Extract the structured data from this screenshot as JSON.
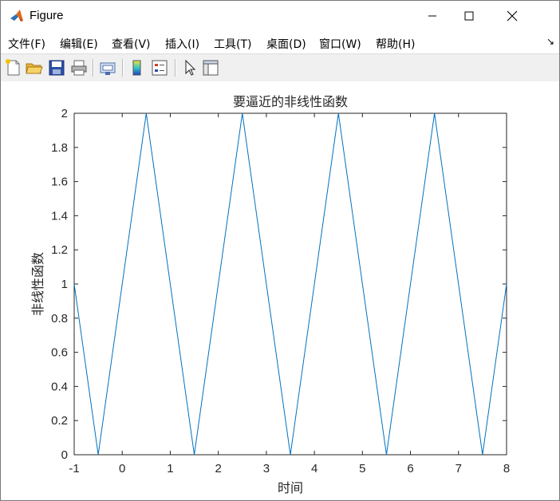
{
  "window": {
    "title": "Figure"
  },
  "menu": {
    "items": [
      {
        "label": "文件(F)",
        "name": "menu-file"
      },
      {
        "label": "编辑(E)",
        "name": "menu-edit"
      },
      {
        "label": "查看(V)",
        "name": "menu-view"
      },
      {
        "label": "插入(I)",
        "name": "menu-insert"
      },
      {
        "label": "工具(T)",
        "name": "menu-tools"
      },
      {
        "label": "桌面(D)",
        "name": "menu-desktop"
      },
      {
        "label": "窗口(W)",
        "name": "menu-window"
      },
      {
        "label": "帮助(H)",
        "name": "menu-help"
      }
    ],
    "extra": "↘"
  },
  "toolbar": {
    "icons": [
      "new-figure-icon",
      "open-file-icon",
      "save-icon",
      "print-icon",
      "link-plot-icon",
      "colorbar-icon",
      "legend-icon",
      "pointer-icon",
      "property-inspector-icon"
    ]
  },
  "chart_data": {
    "type": "line",
    "title": "要逼近的非线性函数",
    "xlabel": "时间",
    "ylabel": "非线性函数",
    "xlim": [
      -1,
      8
    ],
    "ylim": [
      0,
      2
    ],
    "xticks": [
      -1,
      0,
      1,
      2,
      3,
      4,
      5,
      6,
      7,
      8
    ],
    "yticks": [
      0,
      0.2,
      0.4,
      0.6,
      0.8,
      1,
      1.2,
      1.4,
      1.6,
      1.8,
      2
    ],
    "ytick_labels": [
      "0",
      "0.2",
      "0.4",
      "0.6",
      "0.8",
      "1",
      "1.2",
      "1.4",
      "1.6",
      "1.8",
      "2"
    ],
    "grid": false,
    "series": [
      {
        "color": "#0072bd",
        "x": [
          -1,
          -0.5,
          0.5,
          1.5,
          2.5,
          3.5,
          4.5,
          5.5,
          6.5,
          7.5,
          8
        ],
        "y": [
          1,
          0,
          2,
          0,
          2,
          0,
          2,
          0,
          2,
          0,
          1
        ]
      }
    ]
  }
}
